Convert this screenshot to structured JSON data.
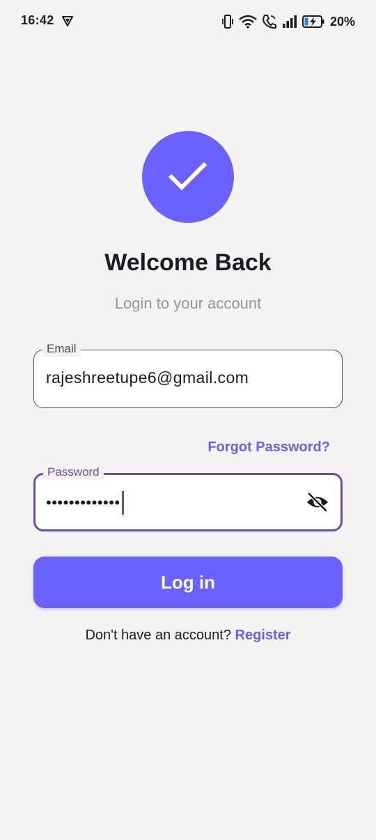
{
  "status_bar": {
    "time": "16:42",
    "battery_percent": "20%",
    "icons": [
      "shield-icon",
      "vibrate-icon",
      "wifi-icon",
      "wifi-call-icon",
      "signal-icon",
      "battery-charging-icon"
    ]
  },
  "logo": {
    "icon": "checkmark-icon",
    "color": "#6a61ff"
  },
  "header": {
    "title": "Welcome Back",
    "subtitle": "Login to your account"
  },
  "email_field": {
    "label": "Email",
    "value": "rajeshreetupe6@gmail.com"
  },
  "forgot_password": {
    "label": "Forgot Password?"
  },
  "password_field": {
    "label": "Password",
    "masked_value": "•••••••••••••",
    "toggle_icon": "eye-off-icon"
  },
  "login_button": {
    "label": "Log in"
  },
  "register_prompt": {
    "text": "Don't have an account?",
    "link_label": "Register"
  },
  "colors": {
    "accent": "#6a61ff",
    "focus_border": "#6a4fa3",
    "background": "#f3f3f4"
  }
}
